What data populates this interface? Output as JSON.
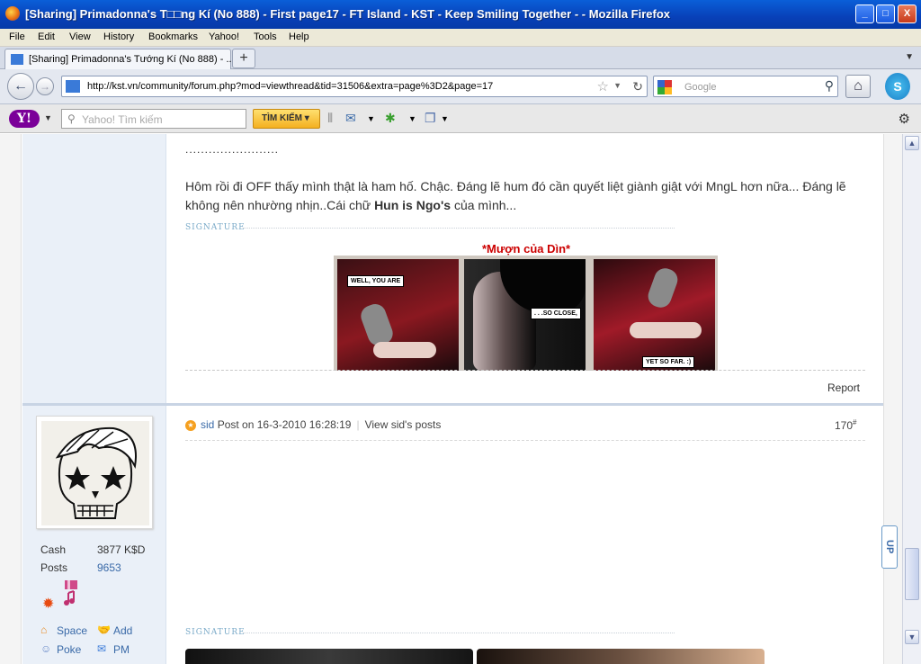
{
  "window": {
    "title": "[Sharing] Primadonna's T□□ng Kí (No 888) - First page17 - FT Island - KST - Keep Smiling Together - - Mozilla Firefox",
    "min": "_",
    "max": "□",
    "close": "X"
  },
  "menu": [
    "File",
    "Edit",
    "View",
    "History",
    "Bookmarks",
    "Yahoo!",
    "Tools",
    "Help"
  ],
  "tab": {
    "label": "[Sharing] Primadonna's Tướng Kí (No 888) - ...",
    "new_label": "+"
  },
  "nav": {
    "url": "http://kst.vn/community/forum.php?mod=viewthread&tid=31506&extra=page%3D2&page=17",
    "search_placeholder": "Google"
  },
  "yahoo": {
    "logo": "Y!",
    "search_placeholder": "Yahoo! Tìm kiếm",
    "search_button": "TÌM KIẾM"
  },
  "post1": {
    "dots": "........................",
    "text_before": "Hôm rồi đi OFF thấy mình thật là ham hố. Chậc. Đáng lẽ hum đó cần quyết liệt giành giật với MngL hơn nữa... Đáng lẽ không nên nhường nhịn..Cái chữ ",
    "text_bold": "Hun is Ngo's",
    "text_after": " của mình...",
    "signature_label": "SIGNATURE",
    "credit": "*Mượn của Dìn*",
    "bubble1": "WELL, YOU ARE",
    "bubble2": ". . .SO CLOSE,",
    "bubble3": "YET SO FAR. :)",
    "report": "Report"
  },
  "post2": {
    "author": "sid",
    "post_on": "Post on 16-3-2010 16:28:19",
    "view_posts": "View sid's posts",
    "number": "170",
    "number_sup": "#",
    "signature_label": "SIGNATURE",
    "stats": [
      {
        "label": "Cash",
        "value": "3877 K$D",
        "color": "#333333"
      },
      {
        "label": "Posts",
        "value": "9653",
        "color": "#3a6aa8"
      }
    ],
    "actions": {
      "space": "Space",
      "add": "Add",
      "poke": "Poke",
      "pm": "PM"
    }
  },
  "up_tab": "UP",
  "colors": {
    "accent": "#3a6aa8",
    "credit": "#cc0000",
    "sidebar": "#eaf0f8"
  }
}
